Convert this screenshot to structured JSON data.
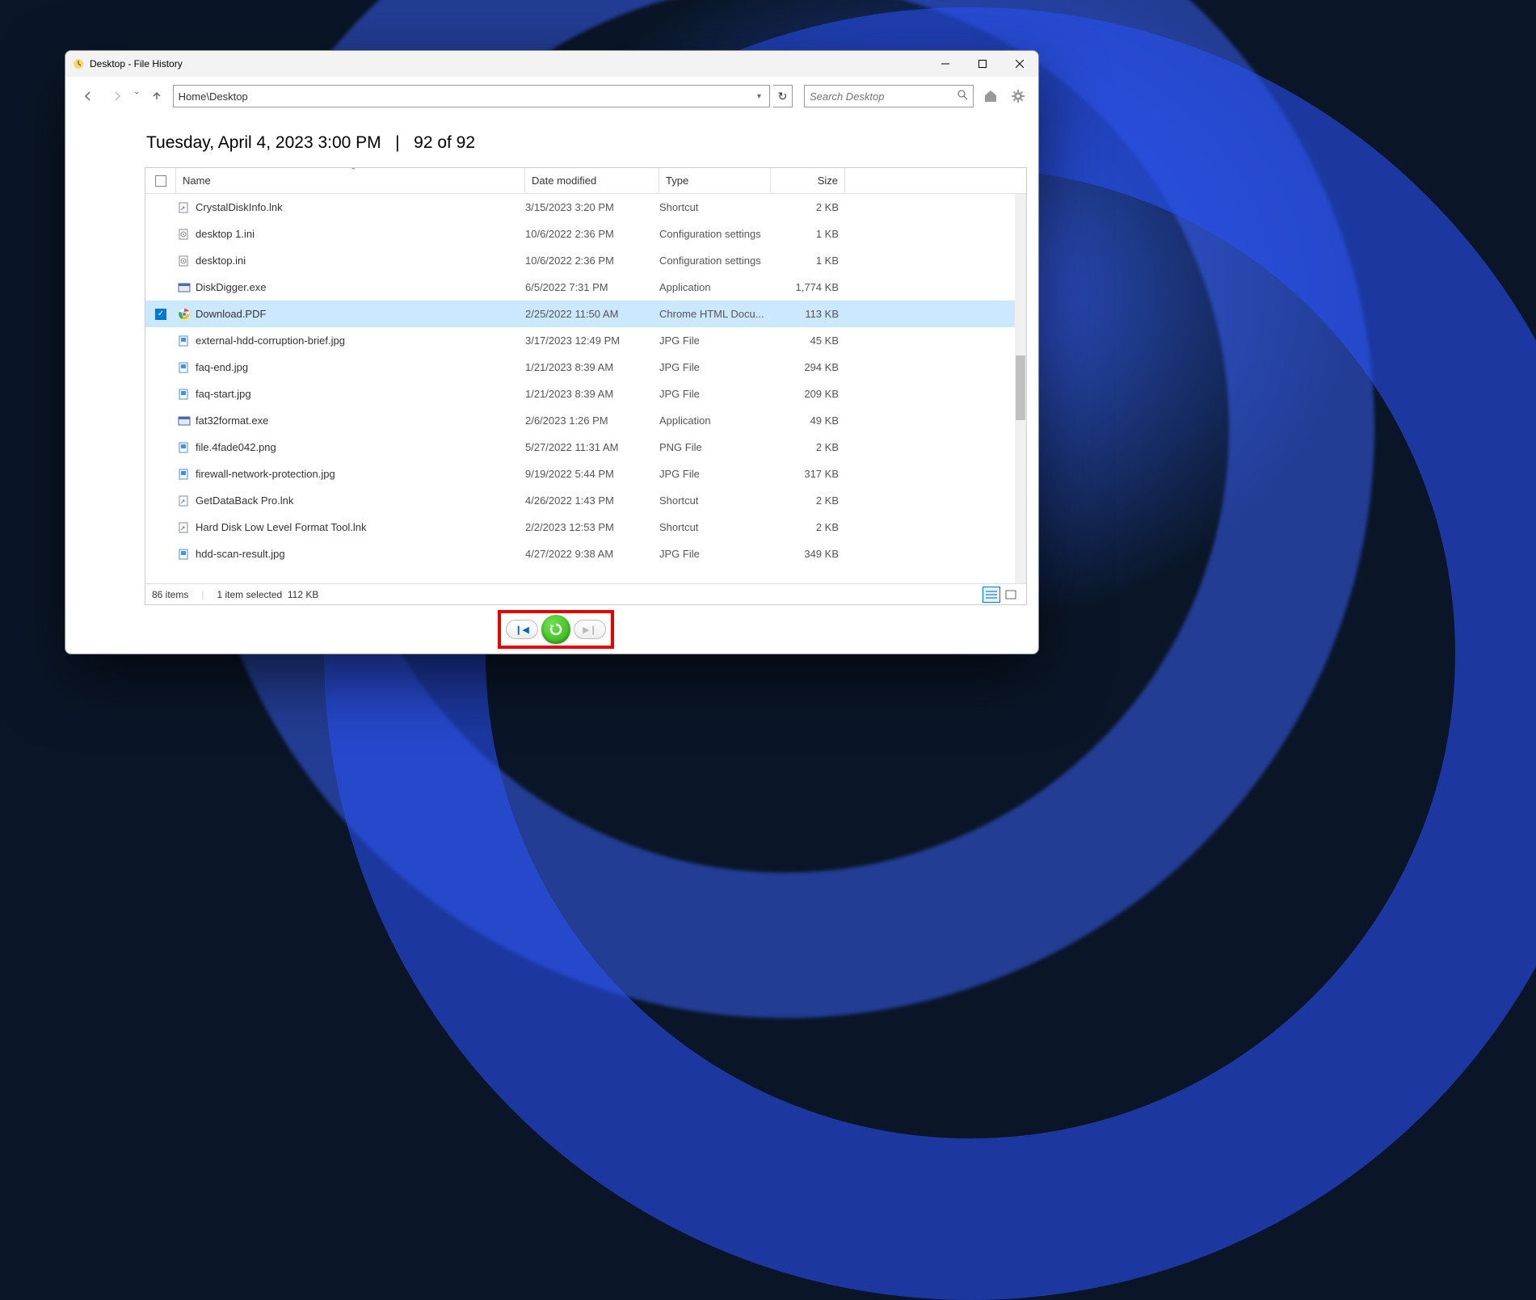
{
  "window": {
    "title": "Desktop - File History"
  },
  "nav": {
    "path": "Home\\Desktop",
    "search_placeholder": "Search Desktop"
  },
  "header": {
    "datetime": "Tuesday, April 4, 2023 3:00 PM",
    "position": "92 of 92"
  },
  "columns": {
    "name": "Name",
    "date": "Date modified",
    "type": "Type",
    "size": "Size"
  },
  "files": [
    {
      "name": "CrystalDiskInfo.lnk",
      "date": "3/15/2023 3:20 PM",
      "type": "Shortcut",
      "size": "2 KB",
      "icon": "shortcut",
      "selected": false
    },
    {
      "name": "desktop 1.ini",
      "date": "10/6/2022 2:36 PM",
      "type": "Configuration settings",
      "size": "1 KB",
      "icon": "ini",
      "selected": false
    },
    {
      "name": "desktop.ini",
      "date": "10/6/2022 2:36 PM",
      "type": "Configuration settings",
      "size": "1 KB",
      "icon": "ini",
      "selected": false
    },
    {
      "name": "DiskDigger.exe",
      "date": "6/5/2022 7:31 PM",
      "type": "Application",
      "size": "1,774 KB",
      "icon": "exe",
      "selected": false
    },
    {
      "name": "Download.PDF",
      "date": "2/25/2022 11:50 AM",
      "type": "Chrome HTML Docu...",
      "size": "113 KB",
      "icon": "chrome",
      "selected": true
    },
    {
      "name": "external-hdd-corruption-brief.jpg",
      "date": "3/17/2023 12:49 PM",
      "type": "JPG File",
      "size": "45 KB",
      "icon": "jpg",
      "selected": false
    },
    {
      "name": "faq-end.jpg",
      "date": "1/21/2023 8:39 AM",
      "type": "JPG File",
      "size": "294 KB",
      "icon": "jpg",
      "selected": false
    },
    {
      "name": "faq-start.jpg",
      "date": "1/21/2023 8:39 AM",
      "type": "JPG File",
      "size": "209 KB",
      "icon": "jpg",
      "selected": false
    },
    {
      "name": "fat32format.exe",
      "date": "2/6/2023 1:26 PM",
      "type": "Application",
      "size": "49 KB",
      "icon": "exe",
      "selected": false
    },
    {
      "name": "file.4fade042.png",
      "date": "5/27/2022 11:31 AM",
      "type": "PNG File",
      "size": "2 KB",
      "icon": "jpg",
      "selected": false
    },
    {
      "name": "firewall-network-protection.jpg",
      "date": "9/19/2022 5:44 PM",
      "type": "JPG File",
      "size": "317 KB",
      "icon": "jpg",
      "selected": false
    },
    {
      "name": "GetDataBack Pro.lnk",
      "date": "4/26/2022 1:43 PM",
      "type": "Shortcut",
      "size": "2 KB",
      "icon": "shortcut",
      "selected": false
    },
    {
      "name": "Hard Disk Low Level Format Tool.lnk",
      "date": "2/2/2023 12:53 PM",
      "type": "Shortcut",
      "size": "2 KB",
      "icon": "shortcut",
      "selected": false
    },
    {
      "name": "hdd-scan-result.jpg",
      "date": "4/27/2022 9:38 AM",
      "type": "JPG File",
      "size": "349 KB",
      "icon": "jpg",
      "selected": false
    }
  ],
  "status": {
    "items": "86 items",
    "selected": "1 item selected",
    "size": "112 KB"
  },
  "colors": {
    "accent": "#0078d4",
    "highlight": "#e60000",
    "restore_green": "#2bb510"
  }
}
